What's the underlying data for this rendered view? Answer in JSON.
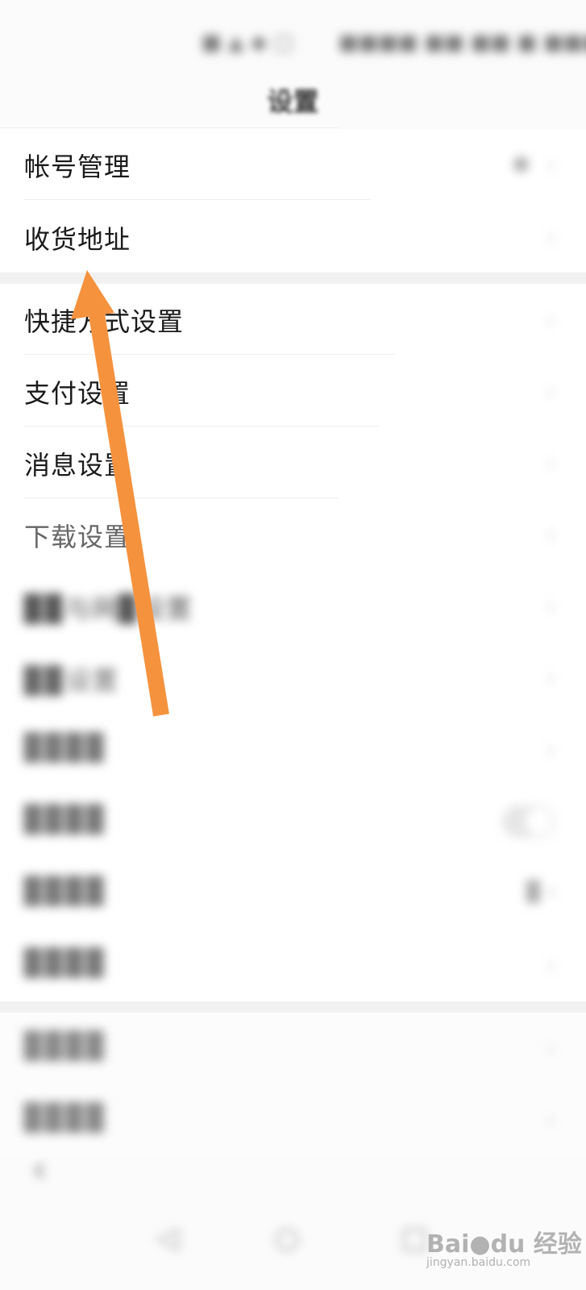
{
  "status_bar": {
    "left": "■ ▲ ◆ □",
    "right": "■■■■ ■■ ■■ ■ ■■■"
  },
  "header": {
    "title": "设置"
  },
  "group1": {
    "items": [
      {
        "label": "帐号管理",
        "icon": "chevron-right-icon"
      },
      {
        "label": "收货地址",
        "icon": "chevron-right-icon"
      }
    ]
  },
  "group2": {
    "items": [
      {
        "label": "快捷方式设置",
        "icon": "chevron-right-icon"
      },
      {
        "label": "支付设置",
        "icon": "chevron-right-icon"
      },
      {
        "label": "消息设置",
        "icon": "chevron-right-icon"
      },
      {
        "label": "下载设置",
        "icon": "chevron-right-icon"
      },
      {
        "label": "▉▉与网▉设置",
        "icon": "chevron-right-icon"
      },
      {
        "label": "▉▉设置",
        "icon": "chevron-right-icon"
      },
      {
        "label": "▉▉▉▉",
        "icon": "chevron-right-icon"
      },
      {
        "label": "▉▉▉▉",
        "icon": "toggle-icon"
      },
      {
        "label": "▉▉▉▉",
        "extra": "▉ ›",
        "icon": "chevron-right-icon"
      },
      {
        "label": "▉▉▉▉",
        "icon": "chevron-right-icon"
      }
    ]
  },
  "group3": {
    "items": [
      {
        "label": "▉▉▉▉",
        "icon": "chevron-right-icon"
      },
      {
        "label": "▉▉▉▉",
        "icon": "chevron-right-icon"
      }
    ]
  },
  "chevron": "›",
  "back_glyph": "‹",
  "bottom_nav": {
    "back": "◁",
    "home": "○",
    "recent": "□"
  },
  "watermark": {
    "brand": "Bai●du 经验",
    "sub": "jingyan.baidu.com"
  },
  "colors": {
    "arrow": "#f5923e",
    "background": "#fbfbfb",
    "row_background": "#ffffff"
  }
}
